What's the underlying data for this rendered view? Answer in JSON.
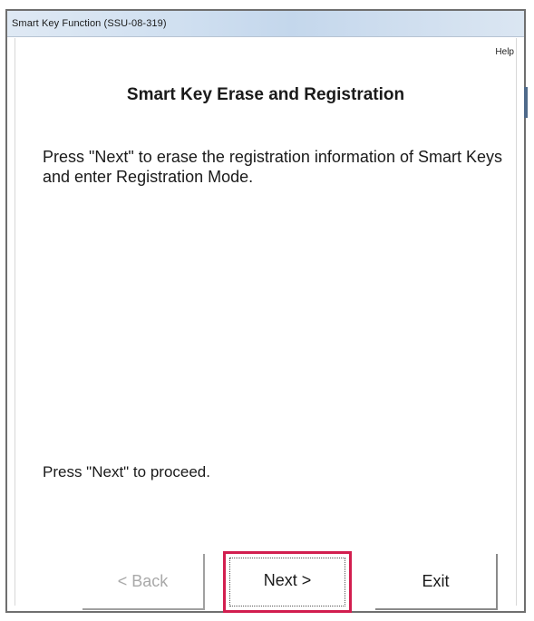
{
  "window": {
    "title": "Smart Key Function (SSU-08-319)"
  },
  "menu": {
    "help_label": "Help"
  },
  "content": {
    "heading": "Smart Key Erase and Registration",
    "message": "Press \"Next\" to erase the registration information of Smart Keys and enter Registration Mode.",
    "proceed_text": "Press \"Next\" to proceed."
  },
  "buttons": {
    "back_label": "< Back",
    "next_label": "Next >",
    "exit_label": "Exit"
  },
  "colors": {
    "focus_highlight": "#d21e4f",
    "disabled_text": "#a9a9a9"
  }
}
